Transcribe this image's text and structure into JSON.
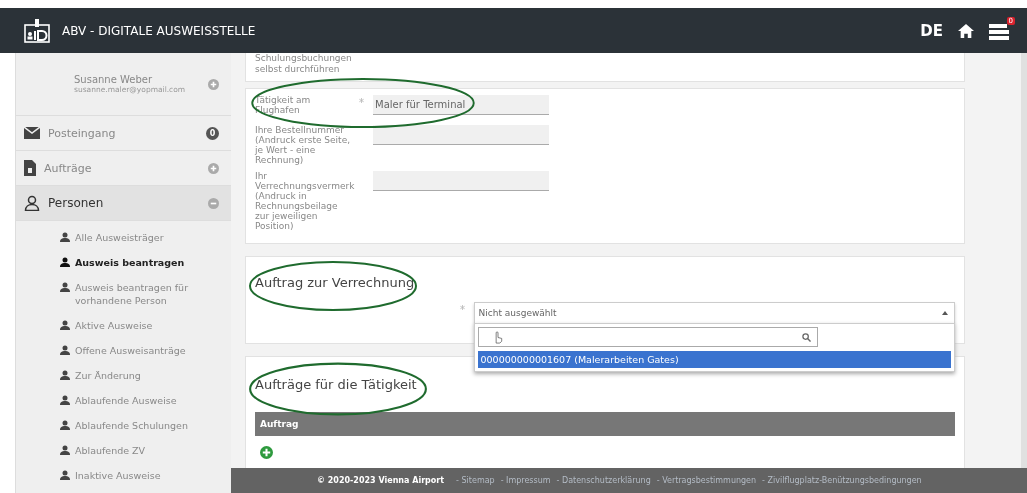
{
  "header": {
    "title": "ABV - DIGITALE AUSWEISSTELLE",
    "language": "DE",
    "notification_count": "0"
  },
  "sidebar": {
    "user": {
      "name": "Susanne Weber",
      "email": "susanne.maler@yopmail.com"
    },
    "items": [
      {
        "label": "Posteingang",
        "kind": "badge",
        "badge": "0",
        "selected": false
      },
      {
        "label": "Aufträge",
        "kind": "toggle",
        "expanded": false,
        "selected": false
      },
      {
        "label": "Personen",
        "kind": "toggle",
        "expanded": true,
        "selected": true,
        "children": [
          {
            "label": "Alle Ausweisträger",
            "selected": false
          },
          {
            "label": "Ausweis beantragen",
            "selected": true
          },
          {
            "label": "Ausweis beantragen für vorhandene Person",
            "selected": false
          },
          {
            "label": "Aktive Ausweise",
            "selected": false
          },
          {
            "label": "Offene Ausweisanträge",
            "selected": false
          },
          {
            "label": "Zur Änderung",
            "selected": false
          },
          {
            "label": "Ablaufende Ausweise",
            "selected": false
          },
          {
            "label": "Ablaufende Schulungen",
            "selected": false
          },
          {
            "label": "Ablaufende ZV",
            "selected": false
          },
          {
            "label": "Inaktive Ausweise",
            "selected": false
          }
        ]
      }
    ]
  },
  "top_card": {
    "label": "Schulungsbuchungen selbst durchführen"
  },
  "form": [
    {
      "label": "Tätigkeit am Flughafen",
      "required": true,
      "value": "Maler für Terminal"
    },
    {
      "label": "Ihre Bestellnummer (Andruck erste Seite, je Wert - eine Rechnung)",
      "required": false
    },
    {
      "label": "Ihr Verrechnungsvermerk (Andruck in Rechnungsbeilage zur jeweiligen Position)",
      "required": false
    }
  ],
  "billing": {
    "heading": "Auftrag zur Verrechnung",
    "required": true,
    "select": {
      "value": "Nicht ausgewählt",
      "expanded": true,
      "options": [
        {
          "label": "000000000001607 (Malerarbeiten Gates)",
          "selected": true
        }
      ]
    }
  },
  "activities": {
    "heading": "Aufträge für die Tätigkeit",
    "table": {
      "columns": [
        "Auftrag"
      ]
    }
  },
  "footer": {
    "copyright": "© 2020-2023 Vienna Airport",
    "links": [
      "- Sitemap",
      "- Impressum",
      "- Datenschutzerklärung",
      "- Vertragsbestimmungen",
      "- Zivilflugplatz-Benützungsbedingungen"
    ]
  }
}
